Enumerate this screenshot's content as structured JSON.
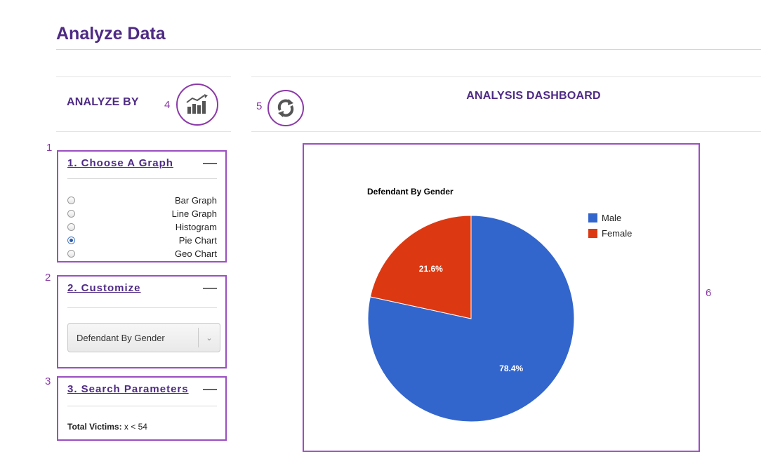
{
  "page": {
    "title": "Analyze Data"
  },
  "left": {
    "header": "ANALYZE BY",
    "marker": "4",
    "icon": "bar-chart-trend-icon"
  },
  "dashboard": {
    "header": "ANALYSIS DASHBOARD",
    "marker": "5",
    "icon": "refresh-icon",
    "chart_marker": "6"
  },
  "panels": {
    "graph": {
      "marker": "1",
      "title": "1. Choose A Graph",
      "collapse": "—",
      "options": [
        {
          "label": "Bar Graph",
          "checked": false
        },
        {
          "label": "Line Graph",
          "checked": false
        },
        {
          "label": "Histogram",
          "checked": false
        },
        {
          "label": "Pie Chart",
          "checked": true
        },
        {
          "label": "Geo Chart",
          "checked": false
        }
      ]
    },
    "customize": {
      "marker": "2",
      "title": "2. Customize",
      "collapse": "—",
      "selected": "Defendant By Gender"
    },
    "search": {
      "marker": "3",
      "title": "3. Search Parameters",
      "collapse": "—",
      "param_label": "Total Victims:",
      "param_value": "x < 54"
    }
  },
  "chart_data": {
    "type": "pie",
    "title": "Defendant By Gender",
    "categories": [
      "Male",
      "Female"
    ],
    "values": [
      78.4,
      21.6
    ],
    "value_labels": [
      "78.4%",
      "21.6%"
    ],
    "colors": [
      "#3366cc",
      "#dc3912"
    ],
    "legend": "right"
  }
}
